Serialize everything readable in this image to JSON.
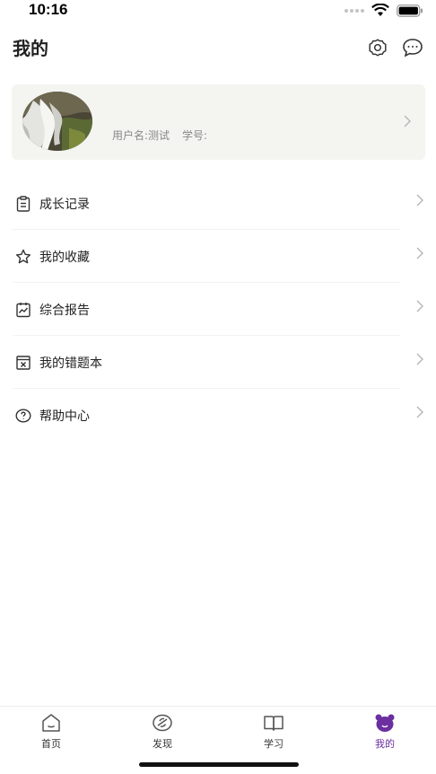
{
  "status_bar": {
    "time": "10:16"
  },
  "header": {
    "title": "我的"
  },
  "profile": {
    "username_label": "用户名:测试",
    "student_id_label": "学号:"
  },
  "menu": [
    {
      "label": "成长记录",
      "icon": "clipboard-icon"
    },
    {
      "label": "我的收藏",
      "icon": "star-icon"
    },
    {
      "label": "综合报告",
      "icon": "report-icon"
    },
    {
      "label": "我的错题本",
      "icon": "error-book-icon"
    },
    {
      "label": "帮助中心",
      "icon": "help-icon"
    }
  ],
  "tabbar": [
    {
      "label": "首页",
      "icon": "home-icon",
      "active": false
    },
    {
      "label": "发现",
      "icon": "discover-icon",
      "active": false
    },
    {
      "label": "学习",
      "icon": "book-icon",
      "active": false
    },
    {
      "label": "我的",
      "icon": "bear-icon",
      "active": true
    }
  ],
  "colors": {
    "accent": "#6b2fa0",
    "card_bg": "#f4f4f1"
  }
}
